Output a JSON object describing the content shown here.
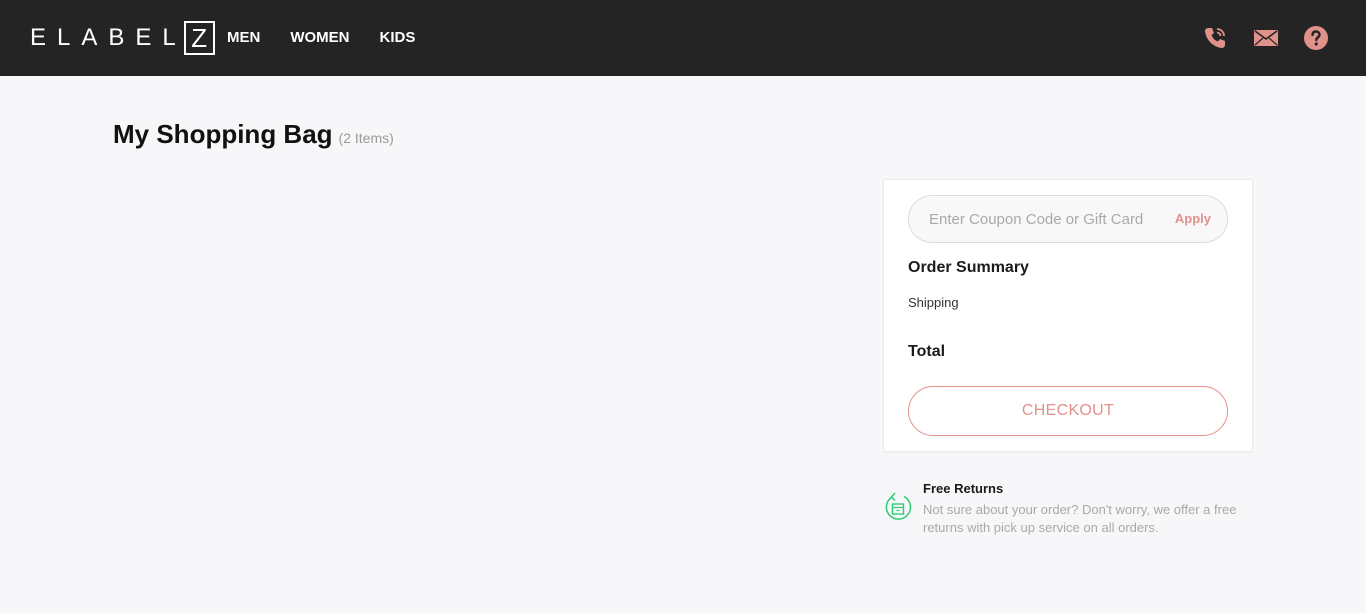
{
  "header": {
    "logo_text": "ELABEL",
    "logo_box_letter": "Z",
    "nav": {
      "men": "MEN",
      "women": "WOMEN",
      "kids": "KIDS"
    },
    "icons": [
      "phone-icon",
      "mail-icon",
      "help-icon"
    ],
    "accent": "#e0918a"
  },
  "page": {
    "title": "My Shopping Bag",
    "count": "(2 Items)"
  },
  "summary": {
    "coupon_placeholder": "Enter Coupon Code or Gift Card",
    "apply_label": "Apply",
    "title": "Order Summary",
    "shipping_label": "Shipping",
    "total_label": "Total",
    "checkout_label": "CHECKOUT"
  },
  "returns": {
    "icon": "return-box-icon",
    "title": "Free Returns",
    "text": "Not sure about your order? Don't worry, we offer a free returns with pick up service on all orders.",
    "icon_color": "#2ecc71"
  }
}
